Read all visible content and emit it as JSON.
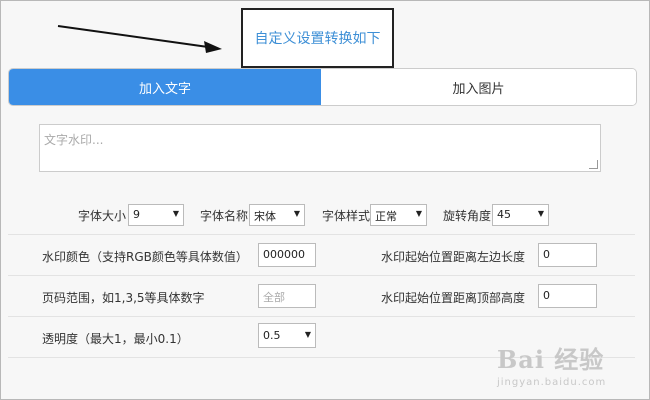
{
  "callout": {
    "text": "自定义设置转换如下"
  },
  "tabs": [
    {
      "label": "加入文字",
      "active": true
    },
    {
      "label": "加入图片",
      "active": false
    }
  ],
  "text_watermark": {
    "placeholder": "文字水印..."
  },
  "font_settings": {
    "size": {
      "label": "字体大小",
      "value": "9"
    },
    "name": {
      "label": "字体名称",
      "value": "宋体"
    },
    "style": {
      "label": "字体样式",
      "value": "正常"
    },
    "rotation": {
      "label": "旋转角度",
      "value": "45"
    }
  },
  "form": {
    "color": {
      "label": "水印颜色（支持RGB颜色等具体数值）",
      "value": "000000"
    },
    "left_offset": {
      "label": "水印起始位置距离左边长度",
      "value": "0"
    },
    "page_range": {
      "label": "页码范围，如1,3,5等具体数字",
      "placeholder": "全部"
    },
    "top_offset": {
      "label": "水印起始位置距离顶部高度",
      "value": "0"
    },
    "opacity": {
      "label": "透明度（最大1，最小0.1）",
      "value": "0.5"
    }
  },
  "colors": {
    "accent": "#3a8ee6",
    "link": "#3d8fd6"
  },
  "watermark": {
    "brand": "Bai 经验",
    "url": "jingyan.baidu.com"
  }
}
